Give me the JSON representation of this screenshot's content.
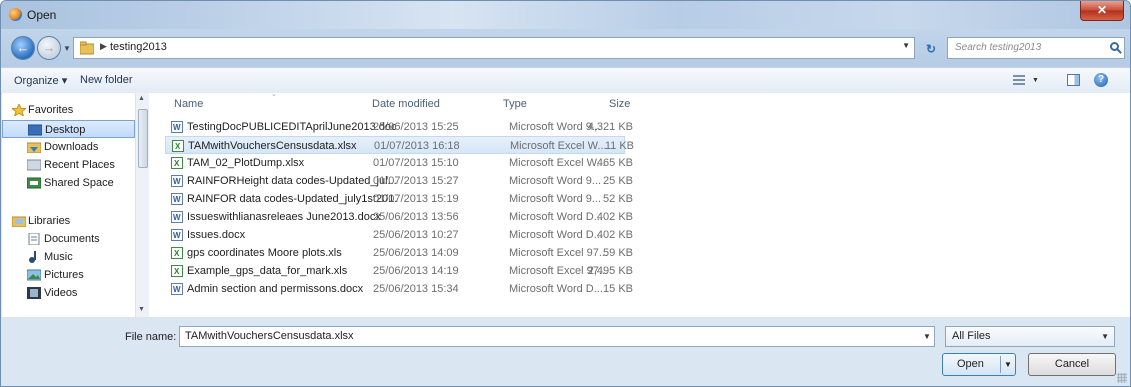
{
  "window": {
    "title": "Open",
    "close_glyph": "✕"
  },
  "address": {
    "breadcrumb": "testing2013",
    "search_placeholder": "Search testing2013"
  },
  "toolbar": {
    "organize": "Organize ▾",
    "new_folder": "New folder",
    "help_glyph": "?"
  },
  "nav": {
    "favorites": "Favorites",
    "items": [
      "Desktop",
      "Downloads",
      "Recent Places",
      "Shared Space"
    ],
    "libraries": "Libraries",
    "library_items": [
      "Documents",
      "Music",
      "Pictures",
      "Videos"
    ],
    "selected": "Desktop"
  },
  "columns": {
    "name": "Name",
    "date": "Date modified",
    "type": "Type",
    "size": "Size"
  },
  "files": [
    {
      "name": "TestingDocPUBLICEDITAprilJune2013.doc",
      "date": "25/06/2013 15:25",
      "type": "Microsoft Word 9...",
      "size": "4,321 KB",
      "kind": "word"
    },
    {
      "name": "TAMwithVouchersCensusdata.xlsx",
      "date": "01/07/2013 16:18",
      "type": "Microsoft Excel W...",
      "size": "11 KB",
      "kind": "excel"
    },
    {
      "name": "TAM_02_PlotDump.xlsx",
      "date": "01/07/2013 15:10",
      "type": "Microsoft Excel W...",
      "size": "465 KB",
      "kind": "excel"
    },
    {
      "name": "RAINFORHeight data codes-Updated_jul...",
      "date": "01/07/2013 15:27",
      "type": "Microsoft Word 9...",
      "size": "25 KB",
      "kind": "word"
    },
    {
      "name": "RAINFOR data codes-Updated_july1st201...",
      "date": "01/07/2013 15:19",
      "type": "Microsoft Word 9...",
      "size": "52 KB",
      "kind": "word"
    },
    {
      "name": "Issueswithlianasreleaes June2013.docx",
      "date": "25/06/2013 13:56",
      "type": "Microsoft Word D...",
      "size": "402 KB",
      "kind": "word"
    },
    {
      "name": "Issues.docx",
      "date": "25/06/2013 10:27",
      "type": "Microsoft Word D...",
      "size": "402 KB",
      "kind": "word"
    },
    {
      "name": "gps coordinates Moore plots.xls",
      "date": "25/06/2013 14:09",
      "type": "Microsoft Excel 97...",
      "size": "59 KB",
      "kind": "excel"
    },
    {
      "name": "Example_gps_data_for_mark.xls",
      "date": "25/06/2013 14:19",
      "type": "Microsoft Excel 97...",
      "size": "2,495 KB",
      "kind": "excel"
    },
    {
      "name": "Admin section and permissons.docx",
      "date": "25/06/2013 15:34",
      "type": "Microsoft Word D...",
      "size": "15 KB",
      "kind": "word"
    }
  ],
  "selected_file": "TAMwithVouchersCensusdata.xlsx",
  "footer": {
    "file_name_label": "File name:",
    "file_name_value": "TAMwithVouchersCensusdata.xlsx",
    "filter_value": "All Files",
    "open_label": "Open",
    "cancel_label": "Cancel"
  }
}
